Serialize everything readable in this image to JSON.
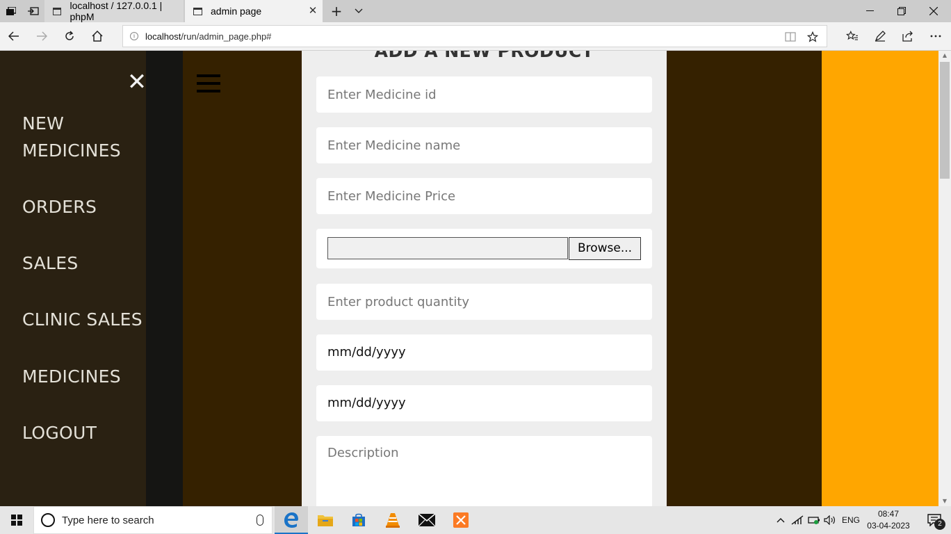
{
  "browser": {
    "tabs": [
      {
        "title": "localhost / 127.0.0.1 | phpM",
        "active": false
      },
      {
        "title": "admin page",
        "active": true
      }
    ],
    "url_host": "localhost",
    "url_path": "/run/admin_page.php#"
  },
  "icons": {
    "tab_manager": "tab-manager-icon",
    "set_aside": "set-aside-tabs-icon",
    "back": "back-arrow-icon",
    "forward": "forward-arrow-icon",
    "refresh": "refresh-icon",
    "home": "home-icon",
    "reading_view": "reading-view-icon",
    "favorite": "star-icon",
    "favorites_hub": "favorites-hub-icon",
    "notes": "pen-icon",
    "share": "share-icon",
    "more": "more-icon"
  },
  "sidebar": {
    "items": [
      {
        "label_line1": "NEW",
        "label_line2": "MEDICINES"
      },
      {
        "label": "ORDERS"
      },
      {
        "label": "SALES"
      },
      {
        "label": "CLINIC SALES"
      },
      {
        "label": "MEDICINES"
      },
      {
        "label": "LOGOUT"
      }
    ]
  },
  "form": {
    "title": "ADD A NEW PRODUCT",
    "medicine_id_placeholder": "Enter Medicine id",
    "medicine_name_placeholder": "Enter Medicine name",
    "medicine_price_placeholder": "Enter Medicine Price",
    "browse_label": "Browse...",
    "quantity_placeholder": "Enter product quantity",
    "date1_value": "mm/dd/yyyy",
    "date2_value": "mm/dd/yyyy",
    "description_placeholder": "Description"
  },
  "colors": {
    "sidebar_bg": "#2a2112",
    "page_bg": "#352100",
    "accent": "#ffa600",
    "card_bg": "#eeeeee"
  },
  "taskbar": {
    "search_placeholder": "Type here to search",
    "language": "ENG",
    "time": "08:47",
    "date": "03-04-2023",
    "notification_count": "2"
  }
}
